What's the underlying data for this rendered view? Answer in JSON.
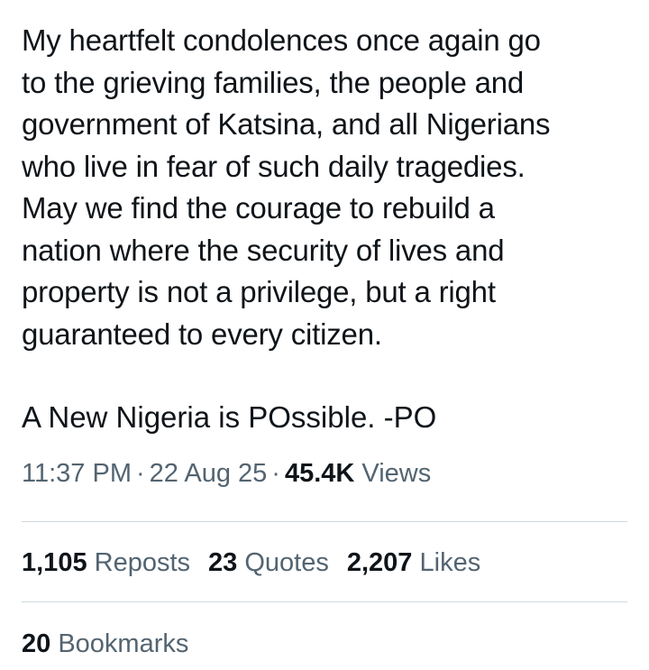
{
  "tweet": {
    "text_lines": [
      "My heartfelt condolences once again go",
      "to the grieving families, the people and",
      "government of Katsina, and all Nigerians",
      "who live in fear of such daily tragedies.",
      "May we find the courage to rebuild a",
      "nation where the security of lives and",
      "property is not a privilege, but a right",
      "guaranteed to every citizen."
    ],
    "signature": "A New Nigeria is POssible. -PO"
  },
  "meta": {
    "time": "11:37 PM",
    "separator": "·",
    "date": "22 Aug 25",
    "views_count": "45.4K",
    "views_label": "Views"
  },
  "stats": {
    "reposts_count": "1,105",
    "reposts_label": "Reposts",
    "quotes_count": "23",
    "quotes_label": "Quotes",
    "likes_count": "2,207",
    "likes_label": "Likes",
    "bookmarks_count": "20",
    "bookmarks_label": "Bookmarks"
  },
  "colors": {
    "text_primary": "#0f1419",
    "text_secondary": "#536471",
    "divider": "#cfd9de"
  }
}
